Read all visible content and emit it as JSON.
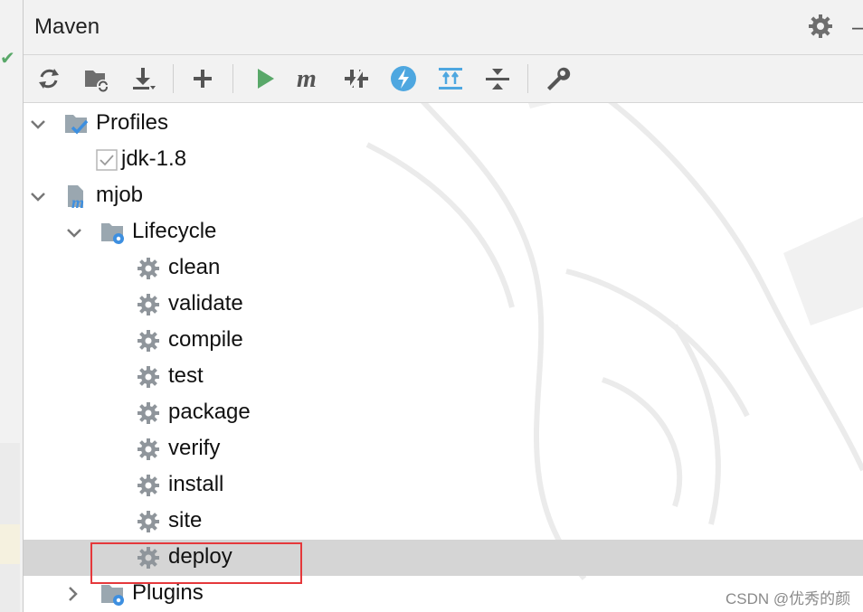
{
  "panel": {
    "title": "Maven"
  },
  "toolbar": [
    {
      "name": "reload-icon"
    },
    {
      "name": "generate-sources-icon"
    },
    {
      "name": "download-icon"
    },
    {
      "name": "add-icon"
    },
    {
      "name": "run-icon"
    },
    {
      "name": "execute-goal-icon"
    },
    {
      "name": "toggle-offline-icon"
    },
    {
      "name": "skip-tests-icon"
    },
    {
      "name": "show-dependencies-icon"
    },
    {
      "name": "collapse-all-icon"
    },
    {
      "name": "settings-wrench-icon"
    }
  ],
  "tree": {
    "profiles": {
      "label": "Profiles",
      "items": [
        {
          "label": "jdk-1.8",
          "checked": true
        }
      ]
    },
    "project": {
      "label": "mjob",
      "lifecycle": {
        "label": "Lifecycle",
        "goals": [
          "clean",
          "validate",
          "compile",
          "test",
          "package",
          "verify",
          "install",
          "site",
          "deploy"
        ],
        "selected": "deploy"
      },
      "plugins": {
        "label": "Plugins"
      }
    }
  },
  "credit": "CSDN @优秀的颜",
  "colors": {
    "accent_green": "#59a869",
    "accent_blue": "#3d8fe0",
    "highlight_red": "#e5383b",
    "selection": "#d5d5d5"
  }
}
